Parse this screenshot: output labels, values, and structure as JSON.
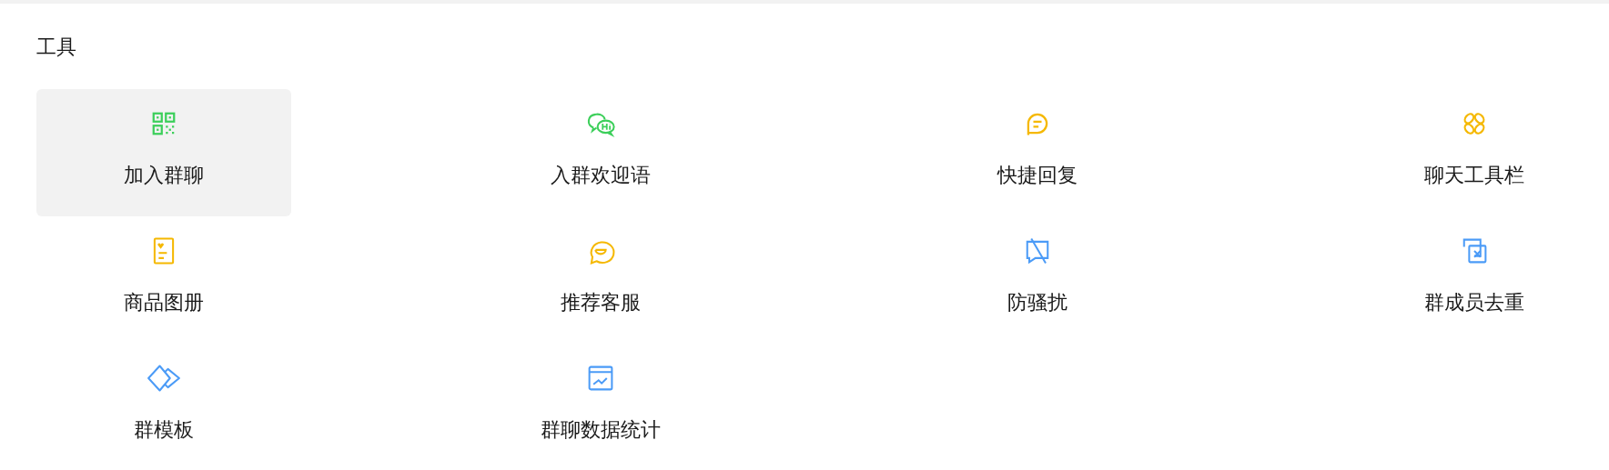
{
  "section": {
    "title": "工具"
  },
  "tools": [
    {
      "label": "加入群聊",
      "selected": true,
      "color": "#3ccf5a"
    },
    {
      "label": "入群欢迎语",
      "selected": false,
      "color": "#3ccf5a"
    },
    {
      "label": "快捷回复",
      "selected": false,
      "color": "#f5b800"
    },
    {
      "label": "聊天工具栏",
      "selected": false,
      "color": "#f5b800"
    },
    {
      "label": "商品图册",
      "selected": false,
      "color": "#f5b800"
    },
    {
      "label": "推荐客服",
      "selected": false,
      "color": "#f5b800"
    },
    {
      "label": "防骚扰",
      "selected": false,
      "color": "#4b9bf7"
    },
    {
      "label": "群成员去重",
      "selected": false,
      "color": "#4b9bf7"
    },
    {
      "label": "群模板",
      "selected": false,
      "color": "#4b9bf7"
    },
    {
      "label": "群聊数据统计",
      "selected": false,
      "color": "#4b9bf7"
    }
  ]
}
